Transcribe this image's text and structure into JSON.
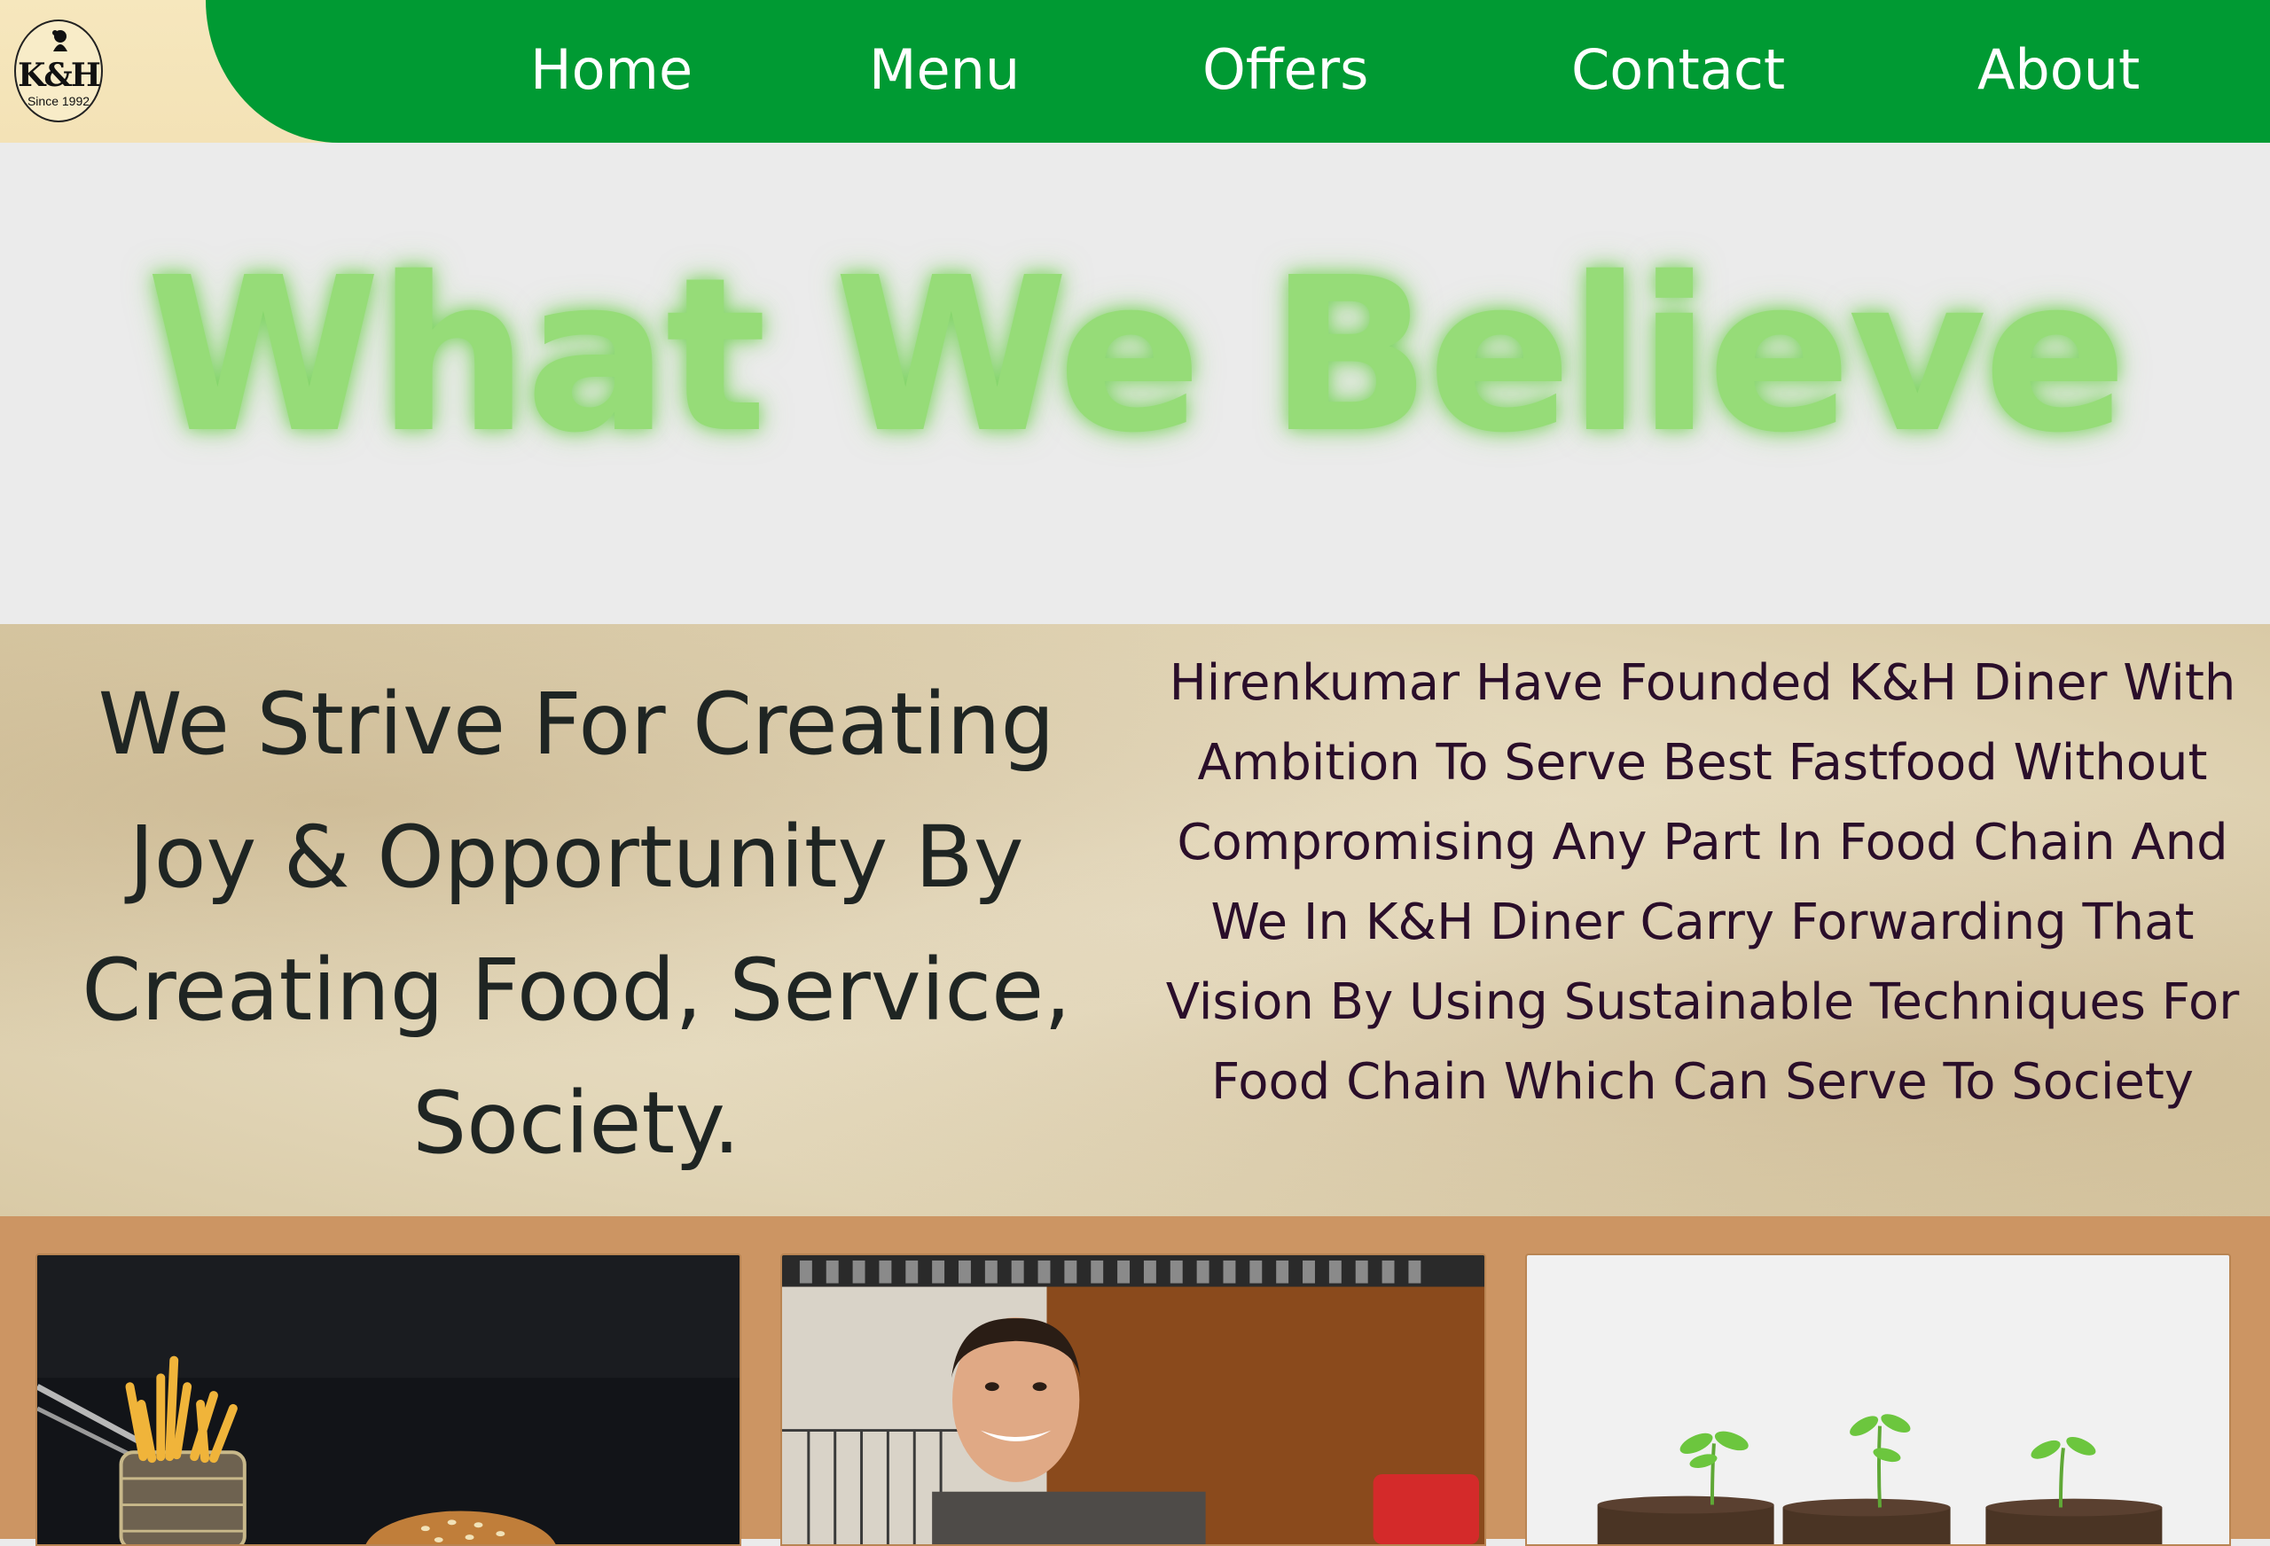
{
  "brand": {
    "logo_mark": "K&H",
    "logo_since": "Since 1992"
  },
  "nav": {
    "items": [
      {
        "label": "Home"
      },
      {
        "label": "Menu"
      },
      {
        "label": "Offers"
      },
      {
        "label": "Contact"
      },
      {
        "label": "About"
      }
    ]
  },
  "hero": {
    "title": "What We Believe"
  },
  "mission": {
    "statement": "We Strive For Creating Joy & Opportunity By Creating Food, Service, Society.",
    "story": "Hirenkumar Have Founded K&H Diner With Ambition To Serve Best Fastfood Without Compromising Any Part In Food Chain And We In K&H Diner Carry Forwarding That Vision By Using Sustainable Techniques For Food Chain Which Can Serve To Society"
  },
  "cards": [
    {
      "image": "burger-and-fries-photo"
    },
    {
      "image": "chef-portrait-photo"
    },
    {
      "image": "seedlings-in-soil-photo"
    }
  ],
  "colors": {
    "nav_green": "#009a33",
    "logo_cream": "#f6e7bd",
    "hero_title_green": "#96dc78",
    "hero_background": "#ebebeb",
    "statement_text": "#1f2523",
    "story_text": "#2a0e2a",
    "cards_background": "#cc9563"
  }
}
